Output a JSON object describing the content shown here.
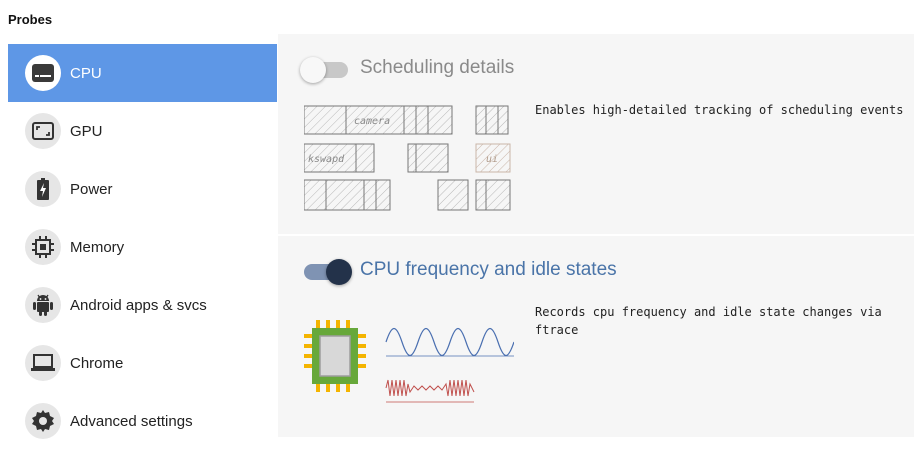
{
  "sidebar": {
    "title": "Probes",
    "items": [
      {
        "label": "CPU",
        "icon": "cpu-display-icon",
        "active": true
      },
      {
        "label": "GPU",
        "icon": "gpu-fullscreen-icon",
        "active": false
      },
      {
        "label": "Power",
        "icon": "battery-charging-icon",
        "active": false
      },
      {
        "label": "Memory",
        "icon": "memory-chip-icon",
        "active": false
      },
      {
        "label": "Android apps & svcs",
        "icon": "android-icon",
        "active": false
      },
      {
        "label": "Chrome",
        "icon": "laptop-icon",
        "active": false
      },
      {
        "label": "Advanced settings",
        "icon": "gear-icon",
        "active": false
      }
    ]
  },
  "probes": [
    {
      "title": "Scheduling details",
      "enabled": false,
      "description": "Enables high-detailed tracking of scheduling events",
      "illustration_labels": [
        "camera",
        "kswapd",
        "ui"
      ]
    },
    {
      "title": "CPU frequency and idle states",
      "enabled": true,
      "description_lines": [
        "Records cpu frequency and idle state changes via",
        "ftrace"
      ]
    }
  ],
  "colors": {
    "accent": "#5e97e6",
    "toggle_on_track": "#7f93b3",
    "toggle_on_knob": "#23324a",
    "probe_title_on": "#4a74a8",
    "probe_title_off": "#8a8a8a"
  }
}
